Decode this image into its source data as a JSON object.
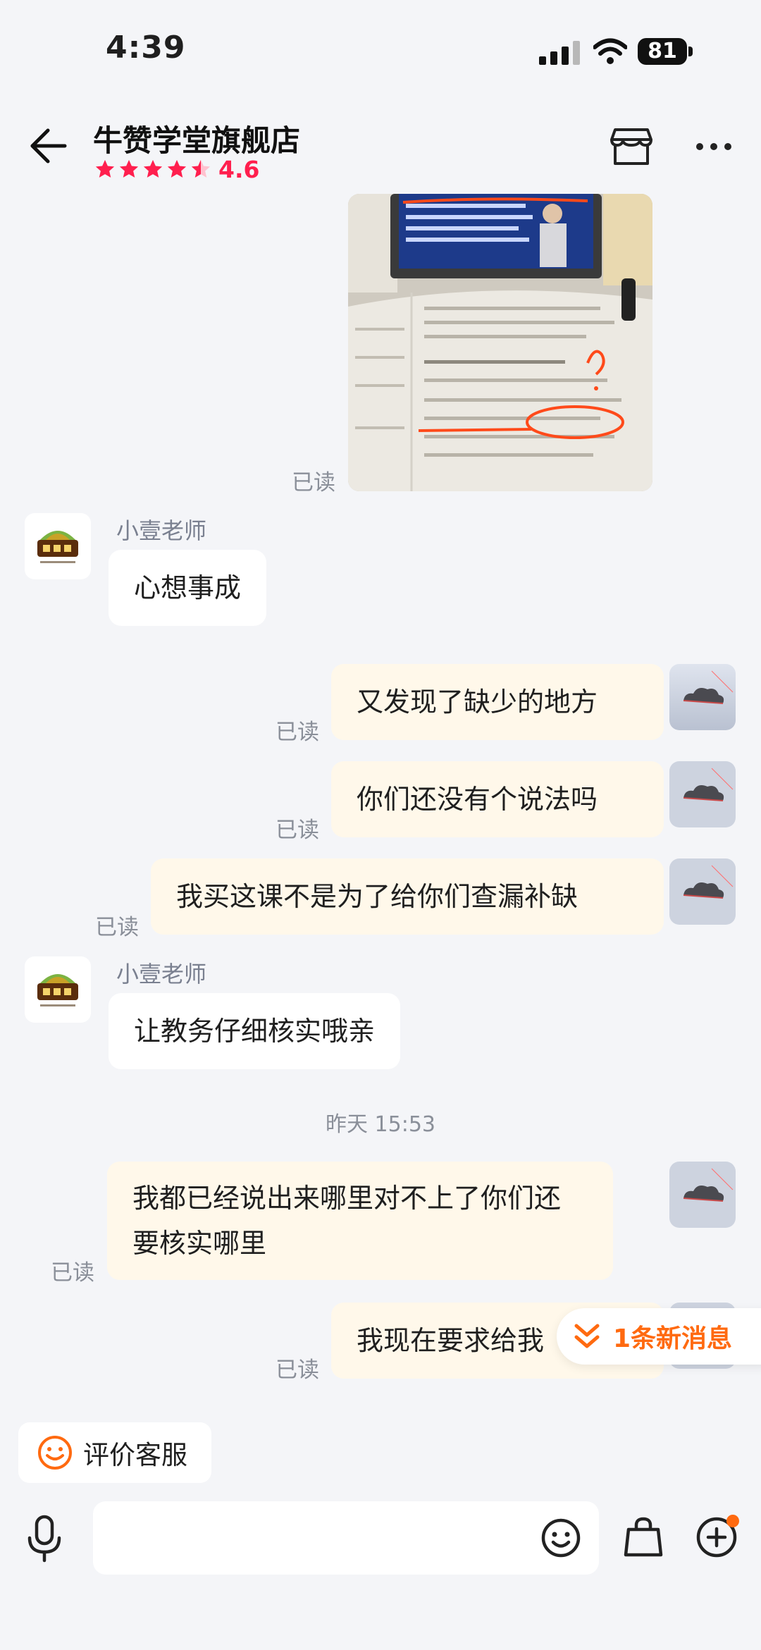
{
  "status_bar": {
    "time": "4:39",
    "battery": "81"
  },
  "header": {
    "shop_name": "牛赞学堂旗舰店",
    "rating": "4.6"
  },
  "messages": {
    "read_label": "已读",
    "shop_sender": "小壹老师",
    "in1": "心想事成",
    "out1": "又发现了缺少的地方",
    "out2": "你们还没有个说法吗",
    "out3": "我买这课不是为了给你们查漏补缺",
    "in2": "让教务仔细核实哦亲",
    "timestamp": "昨天 15:53",
    "out4_line1": "我都已经说出来哪里对不上了你们还",
    "out4_line2": "要核实哪里",
    "out5": "我现在要求给我"
  },
  "new_messages_label": "1条新消息",
  "bottom": {
    "rate_label": "评价客服",
    "input_placeholder": ""
  },
  "colors": {
    "accent": "#ff6a10",
    "rating": "#ff1f4e",
    "out_bubble": "#fff8ea"
  }
}
